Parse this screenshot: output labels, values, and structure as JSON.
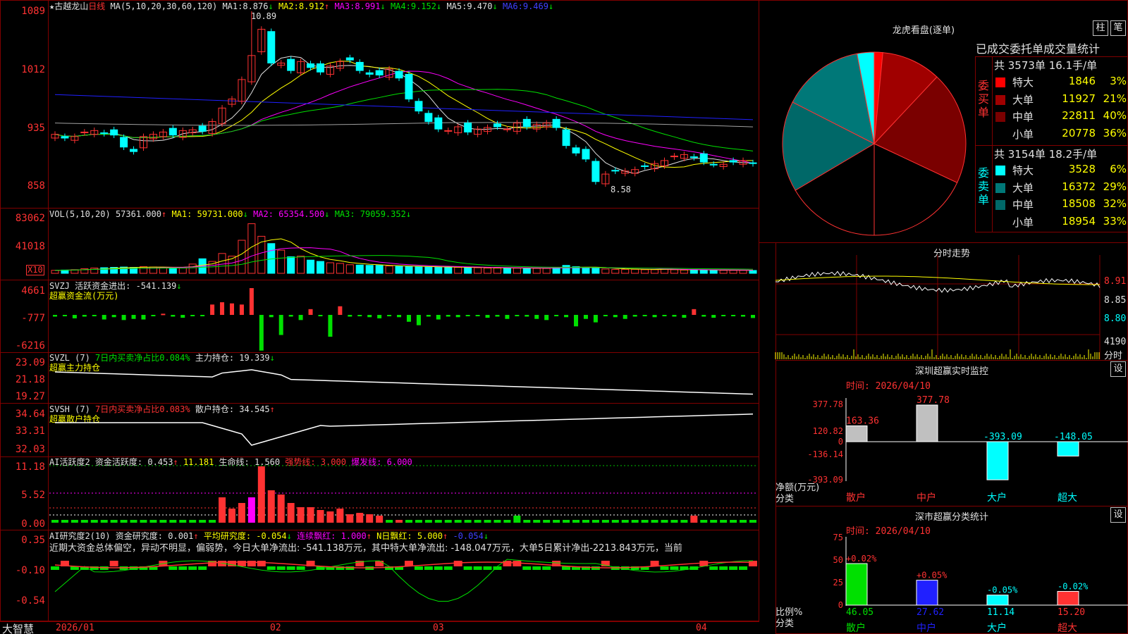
{
  "colors": {
    "up": "#ff3232",
    "down": "#00ffff",
    "frame": "#800000",
    "ma1": "#e0e0e0",
    "ma2": "#ffff00",
    "ma3": "#ff00ff",
    "ma4": "#00e000",
    "ma5": "#a0a0a0",
    "ma6": "#2020ff"
  },
  "header": {
    "star": "★",
    "stock_name": "古越龙山",
    "period": "日线",
    "ma_params": "MA(5,10,20,30,60,120)",
    "ma": [
      {
        "label": "MA1:",
        "value": "8.876",
        "arrow": "↓"
      },
      {
        "label": "MA2:",
        "value": "8.912",
        "arrow": "↑"
      },
      {
        "label": "MA3:",
        "value": "8.991",
        "arrow": "↓"
      },
      {
        "label": "MA4:",
        "value": "9.152",
        "arrow": "↓"
      },
      {
        "label": "MA5:",
        "value": "9.470",
        "arrow": "↓"
      },
      {
        "label": "MA6:",
        "value": "9.469",
        "arrow": "↓"
      }
    ],
    "high_label": "10.89",
    "low_label": "8.58"
  },
  "price_axis": [
    "1089",
    "1012",
    "935",
    "858"
  ],
  "vol": {
    "title": "VOL(5,10,20)",
    "value": "57361.000",
    "arrow": "↑",
    "ma1": "MA1: 59731.000",
    "ma1_arrow": "↓",
    "ma2": "MA2: 65354.500",
    "ma2_arrow": "↓",
    "ma3": "MA3: 79059.352",
    "ma3_arrow": "↓",
    "axis": [
      "83062",
      "41018"
    ],
    "multiplier": "X10"
  },
  "svzj": {
    "title": "SVZJ  活跃资金进出: -541.139",
    "arrow": "↓",
    "subtitle": "超赢资金流(万元)",
    "axis": [
      "4661",
      "-777",
      "-6216"
    ]
  },
  "svzl": {
    "title": "SVZL (7)",
    "ratio": "7日内买卖净占比0.084%",
    "hold": "主力持仓: 19.339",
    "arrow": "↓",
    "subtitle": "超赢主力持仓",
    "axis": [
      "23.09",
      "21.18",
      "19.27"
    ]
  },
  "svsh": {
    "title": "SVSH (7)",
    "ratio": "7日内买卖净占比0.083%",
    "hold": "散户持仓: 34.545",
    "arrow": "↑",
    "subtitle": "超赢散户持仓",
    "axis": [
      "34.64",
      "33.31",
      "32.03"
    ]
  },
  "ai1": {
    "title": "AI活跃度2 资金活跃度: 0.453",
    "arrow": "↑",
    "v2": "11.181",
    "life": "生命线: 1.560",
    "strong": "强势线: 3.000",
    "burst": "爆发线: 6.000",
    "axis": [
      "11.18",
      "5.52",
      "0.00"
    ]
  },
  "ai2": {
    "title": "AI研究度2(10) 资金研究度: 0.001",
    "arrow": "↑",
    "avg": "平均研究度: -0.054",
    "avg_arrow": "↓",
    "cont": "连续飘红: 1.000",
    "cont_arrow": "↑",
    "nred": "N日飘红: 5.000",
    "nred_arrow": "↑",
    "last": "-0.054",
    "last_arrow": "↓",
    "axis": [
      "0.35",
      "-0.10",
      "-0.54"
    ],
    "comment": "近期大资金总体偏空，异动不明显，偏弱势，今日大单净流出: -541.138万元，其中特大单净流出: -148.047万元，大单5日累计净出-2213.843万元，当前"
  },
  "date_axis": [
    "2026/01",
    "02",
    "03",
    "04"
  ],
  "brand": "大智慧",
  "lhb": {
    "title": "龙虎看盘(逐单)",
    "btn1": "柱",
    "btn2": "笔",
    "subtitle": "已成交委托单成交量统计",
    "buy_label": "委买单",
    "buy_total": "共 3573单 16.1手/单",
    "buy_rows": [
      {
        "name": "特大",
        "vol": "1846",
        "pct": "3%",
        "color": "#ff0000"
      },
      {
        "name": "大单",
        "vol": "11927",
        "pct": "21%",
        "color": "#a00000"
      },
      {
        "name": "中单",
        "vol": "22811",
        "pct": "40%",
        "color": "#7a0000"
      },
      {
        "name": "小单",
        "vol": "20778",
        "pct": "36%",
        "color": "#000000"
      }
    ],
    "sell_label": "委卖单",
    "sell_total": "共 3154单 18.2手/单",
    "sell_rows": [
      {
        "name": "特大",
        "vol": "3528",
        "pct": "6%",
        "color": "#00ffff"
      },
      {
        "name": "大单",
        "vol": "16372",
        "pct": "29%",
        "color": "#007878"
      },
      {
        "name": "中单",
        "vol": "18508",
        "pct": "32%",
        "color": "#006868"
      },
      {
        "name": "小单",
        "vol": "18954",
        "pct": "33%",
        "color": "#000000"
      }
    ]
  },
  "fs": {
    "title": "分时走势",
    "axis": [
      "8.91",
      "8.85",
      "8.80"
    ],
    "vol_axis": "4190",
    "vol_label": "分时"
  },
  "monitor": {
    "title": "深圳超赢实时监控",
    "btn": "设",
    "time": "时间: 2026/04/10",
    "axis": [
      "377.78",
      "120.82",
      "0",
      "-136.14",
      "-393.09"
    ],
    "ylabel": "净额(万元)",
    "xlabel": "分类",
    "bars": [
      {
        "cat": "散户",
        "value": 163.36,
        "label": "163.36"
      },
      {
        "cat": "中户",
        "value": 377.78,
        "label": "377.78"
      },
      {
        "cat": "大户",
        "value": -393.09,
        "label": "-393.09"
      },
      {
        "cat": "超大",
        "value": -148.05,
        "label": "-148.05"
      }
    ]
  },
  "stats": {
    "title": "深市超赢分类统计",
    "btn": "设",
    "time": "时间: 2026/04/10",
    "axis": [
      "75",
      "50",
      "25",
      "0"
    ],
    "ylabel": "比例%",
    "xlabel": "分类",
    "bars": [
      {
        "cat": "散户",
        "value": 46.05,
        "label": "46.05",
        "chg": "+0.02%"
      },
      {
        "cat": "中户",
        "value": 27.62,
        "label": "27.62",
        "chg": "+0.05%"
      },
      {
        "cat": "大户",
        "value": 11.14,
        "label": "11.14",
        "chg": "-0.05%"
      },
      {
        "cat": "超大",
        "value": 15.2,
        "label": "15.20",
        "chg": "-0.02%"
      }
    ]
  },
  "chart_data": [
    {
      "type": "candlestick",
      "title": "古越龙山 日线",
      "ylim": [
        8.58,
        10.89
      ],
      "high": 10.89,
      "low": 8.58,
      "close": [
        9.25,
        9.2,
        9.22,
        9.28,
        9.3,
        9.26,
        9.24,
        9.08,
        9.02,
        9.22,
        9.25,
        9.28,
        9.24,
        9.3,
        9.31,
        9.29,
        9.42,
        9.6,
        9.72,
        9.98,
        10.3,
        10.65,
        10.2,
        10.2,
        10.1,
        10.22,
        10.14,
        10.08,
        10.16,
        10.22,
        10.24,
        10.1,
        10.05,
        10.04,
        10.12,
        10.0,
        9.72,
        9.56,
        9.42,
        9.32,
        9.3,
        9.35,
        9.28,
        9.32,
        9.34,
        9.35,
        9.32,
        9.4,
        9.35,
        9.38,
        9.4,
        9.34,
        9.1,
        9.0,
        8.92,
        8.62,
        8.72,
        8.76,
        8.76,
        8.78,
        8.82,
        8.86,
        8.9,
        8.96,
        8.98,
        8.94,
        8.88,
        8.85,
        8.85,
        8.88,
        8.9,
        8.86
      ]
    },
    {
      "type": "bar",
      "title": "VOL(5,10,20)",
      "ylim": [
        0,
        83062
      ],
      "values": [
        4500,
        5000,
        5500,
        7000,
        8000,
        8500,
        9000,
        9500,
        9000,
        10000,
        9500,
        9000,
        8500,
        9000,
        14000,
        22000,
        18000,
        30000,
        26000,
        50000,
        75000,
        56000,
        45000,
        35000,
        25000,
        26000,
        20000,
        18000,
        16000,
        15000,
        13000,
        12500,
        12000,
        12000,
        11000,
        10500,
        10000,
        10000,
        9500,
        9500,
        9000,
        9000,
        8500,
        8500,
        8000,
        8000,
        8000,
        7800,
        7800,
        7500,
        7500,
        9000,
        12000,
        10000,
        8000,
        7500,
        6500,
        6000,
        6000,
        6000,
        5500,
        5500,
        6000,
        5500,
        5000,
        5000,
        5000,
        5000,
        4500,
        4500,
        4500,
        4300
      ]
    },
    {
      "type": "bar",
      "title": "SVZJ 活跃资金进出",
      "values": [
        -300,
        -200,
        -600,
        -300,
        -100,
        -800,
        -400,
        -900,
        -700,
        -800,
        -200,
        200,
        -300,
        -500,
        -200,
        -100,
        1800,
        2200,
        2000,
        1800,
        4661,
        -6216,
        -400,
        -3500,
        -300,
        -900,
        1000,
        -100,
        -3800,
        1500,
        -300,
        -100,
        -400,
        -600,
        -200,
        -400,
        -1200,
        -1800,
        -300,
        -800,
        -300,
        -400,
        -200,
        -100,
        -500,
        -300,
        -700,
        -200,
        -300,
        -700,
        -900,
        -200,
        -400,
        -2000,
        -700,
        -1300,
        -200,
        -400,
        -700,
        -300,
        -200,
        -400,
        -100,
        -300,
        -500,
        1000,
        -300,
        -500,
        -200,
        -100,
        -300,
        -541.139
      ]
    }
  ]
}
